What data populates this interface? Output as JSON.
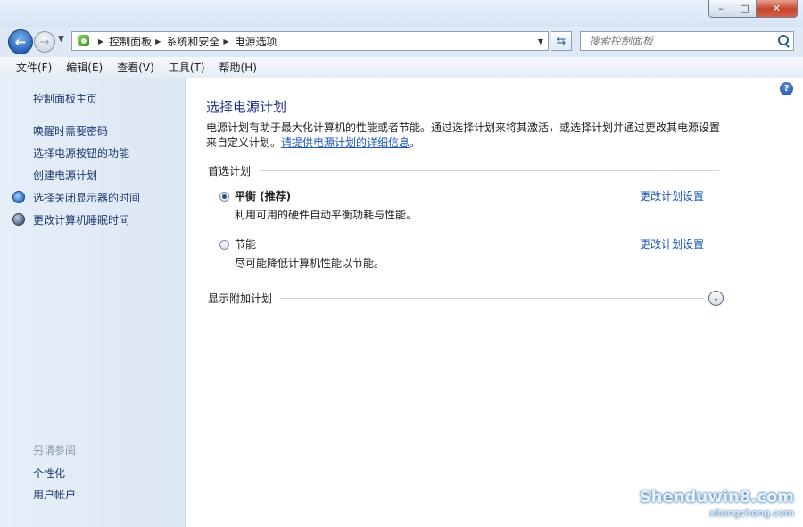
{
  "titlebar": {
    "minimize_glyph": "–",
    "maximize_glyph": "□",
    "close_glyph": "✕"
  },
  "nav": {
    "back_glyph": "←",
    "forward_glyph": "→",
    "recent_glyph": "▼",
    "breadcrumbs": [
      "控制面板",
      "系统和安全",
      "电源选项"
    ],
    "crumb_separator": "▶",
    "address_dropdown_glyph": "▼",
    "refresh_glyph": "⇆",
    "search_placeholder": "搜索控制面板"
  },
  "menubar": {
    "items": [
      "文件(F)",
      "编辑(E)",
      "查看(V)",
      "工具(T)",
      "帮助(H)"
    ]
  },
  "sidebar": {
    "home": "控制面板主页",
    "links": [
      "唤醒时需要密码",
      "选择电源按钮的功能",
      "创建电源计划",
      "选择关闭显示器的时间",
      "更改计算机睡眠时间"
    ],
    "see_also_title": "另请参阅",
    "see_also": [
      "个性化",
      "用户帐户"
    ]
  },
  "main": {
    "help_glyph": "?",
    "title": "选择电源计划",
    "description": "电源计划有助于最大化计算机的性能或者节能。通过选择计划来将其激活，或选择计划并通过更改其电源设置来自定义计划。",
    "details_link": "请提供电源计划的详细信息",
    "description_end": "。",
    "section_label": "首选计划",
    "plans": [
      {
        "name": "平衡 (推荐)",
        "description": "利用可用的硬件自动平衡功耗与性能。",
        "selected": true,
        "link": "更改计划设置"
      },
      {
        "name": "节能",
        "description": "尽可能降低计算机性能以节能。",
        "selected": false,
        "link": "更改计划设置"
      }
    ],
    "extra_label": "显示附加计划",
    "expand_glyph": "⌄"
  },
  "watermark": {
    "line1": "Shenduwin8.com",
    "line2": "xitongcheng.com"
  }
}
